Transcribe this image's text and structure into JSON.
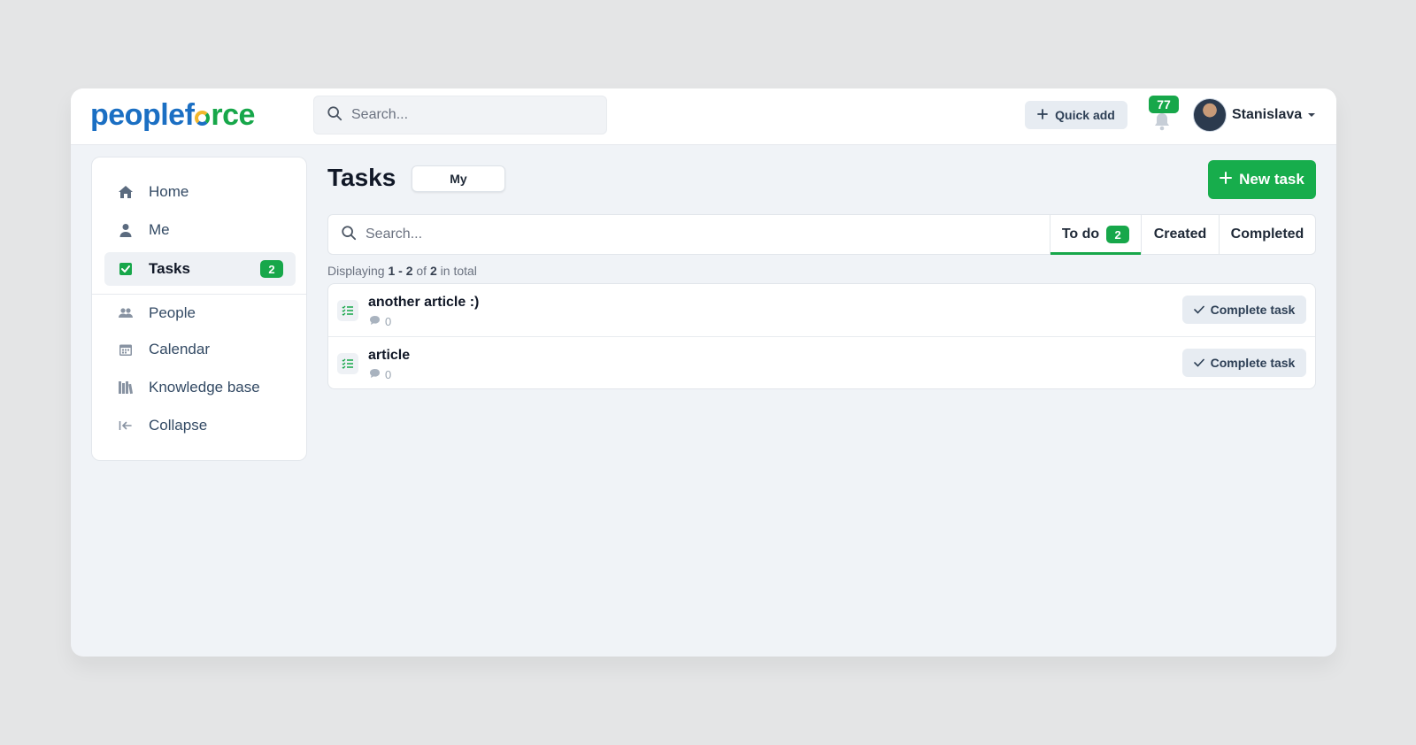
{
  "header": {
    "logo": {
      "part1": "peoplef",
      "part2": "rce"
    },
    "search_placeholder": "Search...",
    "quick_add_label": "Quick add",
    "notifications_count": "77",
    "user_name": "Stanislava"
  },
  "sidebar": {
    "items": [
      {
        "label": "Home",
        "icon": "home-icon"
      },
      {
        "label": "Me",
        "icon": "user-icon"
      },
      {
        "label": "Tasks",
        "icon": "checkbox-icon",
        "badge": "2",
        "active": true
      },
      {
        "label": "People",
        "icon": "people-icon"
      },
      {
        "label": "Calendar",
        "icon": "calendar-icon"
      },
      {
        "label": "Knowledge base",
        "icon": "books-icon"
      },
      {
        "label": "Collapse",
        "icon": "collapse-icon"
      }
    ]
  },
  "main": {
    "title": "Tasks",
    "scope_toggle": "My",
    "new_task_label": "New task",
    "search_placeholder": "Search...",
    "tabs": [
      {
        "label": "To do",
        "badge": "2",
        "active": true
      },
      {
        "label": "Created"
      },
      {
        "label": "Completed"
      }
    ],
    "display_info": {
      "prefix": "Displaying",
      "range": "1 - 2",
      "of": "of",
      "total": "2",
      "suffix": "in total"
    },
    "tasks": [
      {
        "title": "another article :)",
        "comments": "0",
        "action": "Complete task"
      },
      {
        "title": "article",
        "comments": "0",
        "action": "Complete task"
      }
    ]
  },
  "colors": {
    "accent": "#17a74a",
    "brand_blue": "#1b6fc3"
  }
}
